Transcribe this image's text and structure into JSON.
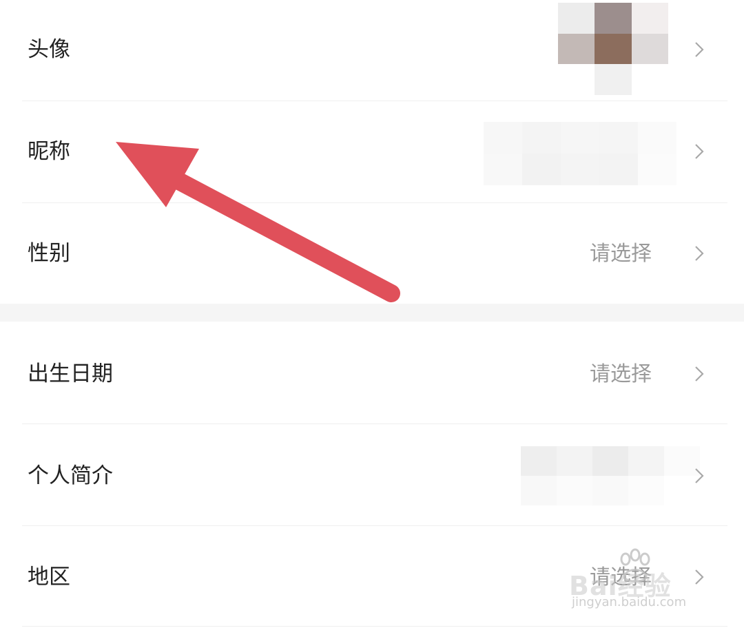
{
  "rows": [
    {
      "id": "avatar",
      "label": "头像",
      "value": ""
    },
    {
      "id": "nickname",
      "label": "昵称",
      "value": ""
    },
    {
      "id": "gender",
      "label": "性别",
      "value": "请选择"
    },
    {
      "id": "birthday",
      "label": "出生日期",
      "value": "请选择"
    },
    {
      "id": "bio",
      "label": "个人简介",
      "value": ""
    },
    {
      "id": "region",
      "label": "地区",
      "value": "请选择"
    }
  ],
  "icons": {
    "chevron": "chevron-right-icon",
    "annotation": "red-arrow-icon",
    "watermark": "baidu-paw-icon"
  },
  "colors": {
    "arrow": "#e0505a",
    "label": "#222222",
    "value": "#9a9a9a",
    "separator": "#f5f5f5"
  },
  "watermark": {
    "brand": "Bai",
    "brand_suffix": "经验",
    "url": "jingyan.baidu.com"
  }
}
